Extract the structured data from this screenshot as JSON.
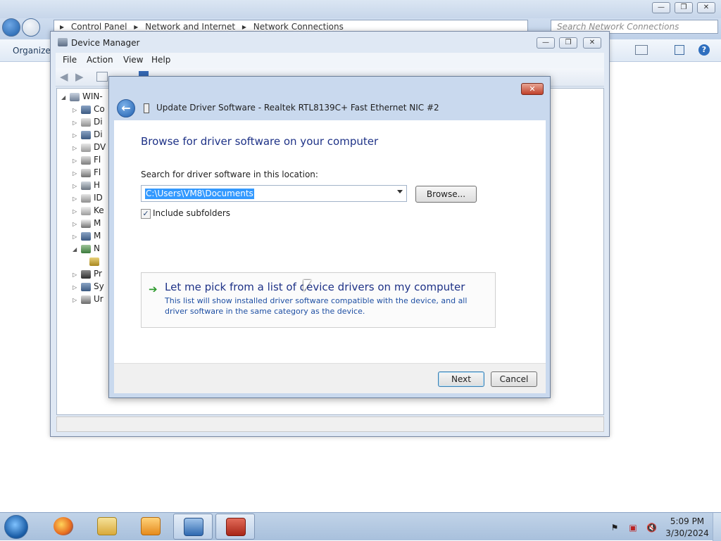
{
  "explorer": {
    "breadcrumb": [
      "Control Panel",
      "Network and Internet",
      "Network Connections"
    ],
    "search_placeholder": "Search Network Connections",
    "toolbar": {
      "organize_label": "Organize"
    }
  },
  "device_manager": {
    "title": "Device Manager",
    "menu": [
      "File",
      "Action",
      "View",
      "Help"
    ],
    "tree_root": "WIN-",
    "tree_items": [
      "Co",
      "Di",
      "Di",
      "DV",
      "Fl",
      "Fl",
      "H",
      "ID",
      "Ke",
      "M",
      "M",
      "N",
      "",
      "Pr",
      "Sy",
      "Ur"
    ]
  },
  "dialog": {
    "title": "Update Driver Software - Realtek RTL8139C+ Fast Ethernet NIC #2",
    "heading": "Browse for driver software on your computer",
    "search_label": "Search for driver software in this location:",
    "path_value": "C:\\Users\\VM8\\Documents",
    "browse_label": "Browse...",
    "include_subfolders_label": "Include subfolders",
    "include_subfolders_checked": true,
    "pick_title": "Let me pick from a list of device drivers on my computer",
    "pick_desc": "This list will show installed driver software compatible with the device, and all driver software in the same category as the device.",
    "next_label": "Next",
    "cancel_label": "Cancel",
    "close_glyph": "✕"
  },
  "taskbar": {
    "apps": [
      {
        "name": "firefox",
        "color": "#e66a1f"
      },
      {
        "name": "explorer",
        "color": "#e8c25a"
      },
      {
        "name": "media-player",
        "color": "#f0a030"
      },
      {
        "name": "network-connections",
        "color": "#3e7cc0"
      },
      {
        "name": "device-manager",
        "color": "#c0392b"
      }
    ],
    "clock_time": "5:09 PM",
    "clock_date": "3/30/2024"
  },
  "colors": {
    "heading_blue": "#1e3287",
    "selection_blue": "#3399ff",
    "link_green": "#2d9a2d"
  }
}
